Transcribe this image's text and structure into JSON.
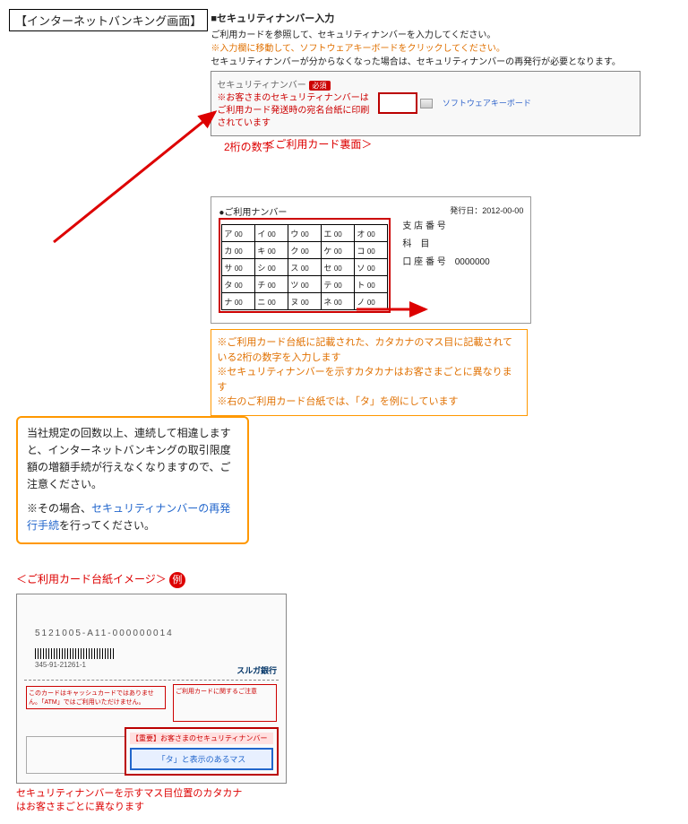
{
  "title": "【インターネットバンキング画面】",
  "section": "■セキュリティナンバー入力",
  "instr1": "ご利用カードを参照して、セキュリティナンバーを入力してください。",
  "instr2": "※入力欄に移動して、ソフトウェアキーボードをクリックしてください。",
  "instr3": "セキュリティナンバーが分からなくなった場合は、セキュリティナンバーの再発行が必要となります。",
  "panel": {
    "label": "セキュリティナンバー",
    "badge": "必須",
    "note": "※お客さまのセキュリティナンバーはご利用カード発送時の宛名台紙に印刷されています",
    "softkb": "ソフトウェアキーボード"
  },
  "annot_two_digit": "2桁の数字",
  "bubble": {
    "line1": "当社規定の回数以上、連続して相違しますと、インターネットバンキングの取引限度額の増額手続が行えなくなりますので、ご注意ください。",
    "line2a": "※その場合、",
    "line2b": "セキュリティナンバーの再発行手続",
    "line2c": "を行ってください。"
  },
  "cardback": {
    "heading": "＜ご利用カード裏面＞",
    "label": "●ご利用ナンバー",
    "issue_label": "発行日：",
    "issue_date": "2012-00-00",
    "rows": [
      [
        "ア",
        "イ",
        "ウ",
        "エ",
        "オ"
      ],
      [
        "カ",
        "キ",
        "ク",
        "ケ",
        "コ"
      ],
      [
        "サ",
        "シ",
        "ス",
        "セ",
        "ソ"
      ],
      [
        "タ",
        "チ",
        "ツ",
        "テ",
        "ト"
      ],
      [
        "ナ",
        "ニ",
        "ヌ",
        "ネ",
        "ノ"
      ]
    ],
    "cell_num": "00",
    "fields": {
      "branch": "支 店 番 号",
      "subject": "科　目",
      "account": "口 座 番 号",
      "account_no": "0000000"
    }
  },
  "explain": {
    "l1": "※ご利用カード台紙に記載された、カタカナのマス目に記載されている2桁の数字を入力します",
    "l2": "※セキュリティナンバーを示すカタカナはお客さまごとに異なります",
    "l3": "※右のご利用カード台紙では、「タ」を例にしています"
  },
  "cardimg": {
    "heading": "＜ご利用カード台紙イメージ＞",
    "ex": "例",
    "number": "5121005-A11-000000014",
    "barcode_num": "345-91-21261-1",
    "bank": "スルガ銀行",
    "warn": "このカードはキャッシュカードではありません。「ATM」ではご利用いただけません。",
    "care_head": "ご利用カードに関するご注意",
    "sec_head": "【重要】お客さまのセキュリティナンバー",
    "sec_cell": "「タ」と表示のあるマス",
    "annot": "セキュリティナンバーを示すマス目位置のカタカナはお客さまごとに異なります"
  }
}
